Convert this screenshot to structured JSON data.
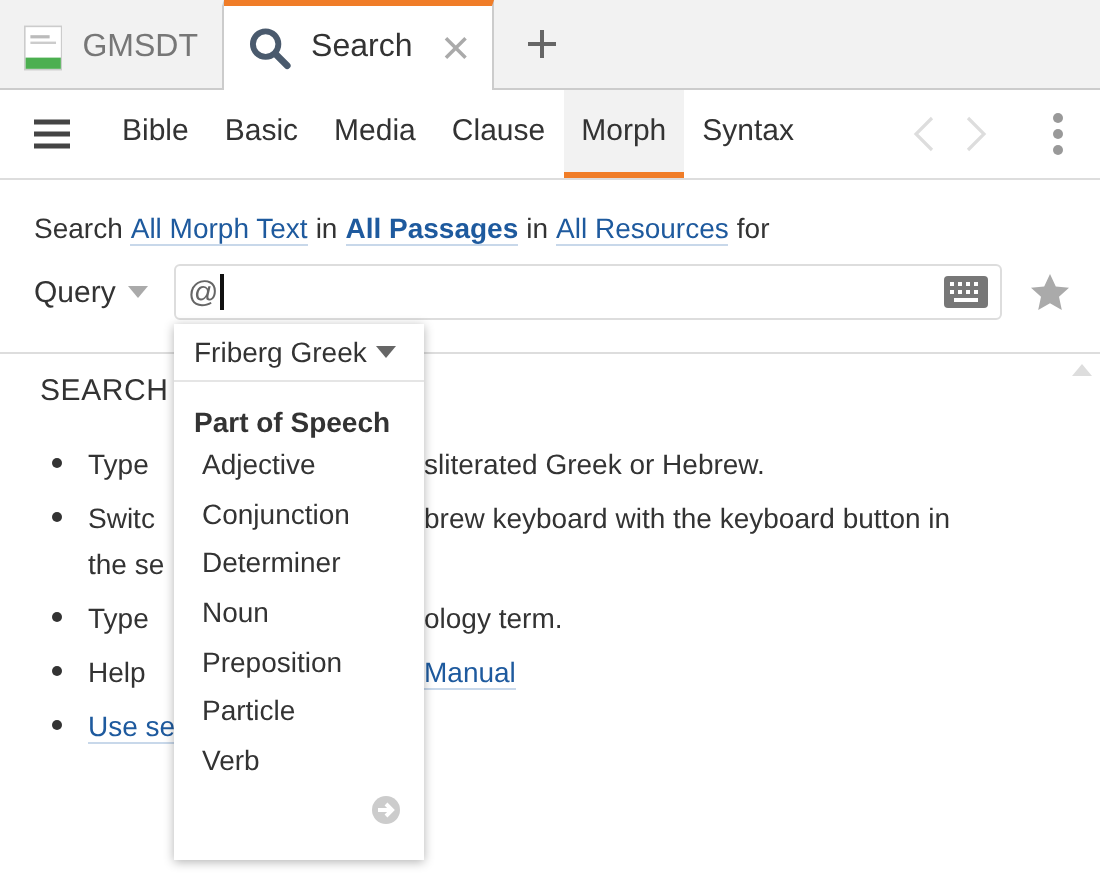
{
  "tabs": [
    {
      "label": "GMSDT",
      "kind": "document",
      "selected": false,
      "closable": false
    },
    {
      "label": "Search",
      "kind": "search",
      "selected": true,
      "closable": true
    }
  ],
  "toolbar": {
    "tabs": [
      {
        "label": "Bible",
        "selected": false
      },
      {
        "label": "Basic",
        "selected": false
      },
      {
        "label": "Media",
        "selected": false
      },
      {
        "label": "Clause",
        "selected": false
      },
      {
        "label": "Morph",
        "selected": true
      },
      {
        "label": "Syntax",
        "selected": false
      }
    ]
  },
  "scope": [
    {
      "text": "Search",
      "kind": "plain"
    },
    {
      "text": "All Morph Text",
      "kind": "link"
    },
    {
      "text": "in",
      "kind": "plain"
    },
    {
      "text": "All Passages",
      "kind": "strong-link"
    },
    {
      "text": "in",
      "kind": "plain"
    },
    {
      "text": "All Resources",
      "kind": "link"
    },
    {
      "text": "for",
      "kind": "plain"
    }
  ],
  "query": {
    "label": "Query",
    "value": "@"
  },
  "help": {
    "heading": "SEARCH",
    "bullets": [
      {
        "lines": [
          {
            "left": "Type",
            "right": "sliterated Greek or Hebrew.",
            "right_link": false
          }
        ]
      },
      {
        "lines": [
          {
            "left": "Switc",
            "right": "brew keyboard with the keyboard button in",
            "right_link": false
          },
          {
            "left": "the se"
          }
        ]
      },
      {
        "lines": [
          {
            "left": "Type",
            "right": "ology term.",
            "right_link": false
          }
        ]
      },
      {
        "lines": [
          {
            "left": "Help",
            "right": "Manual",
            "right_link": true
          }
        ]
      },
      {
        "lines": [
          {
            "left": "Use se",
            "left_link": true
          }
        ]
      }
    ]
  },
  "popup": {
    "dropdown": "Friberg Greek",
    "heading": "Part of Speech",
    "items": [
      "Adjective",
      "Conjunction",
      "Determiner",
      "Noun",
      "Preposition",
      "Particle",
      "Verb"
    ]
  }
}
